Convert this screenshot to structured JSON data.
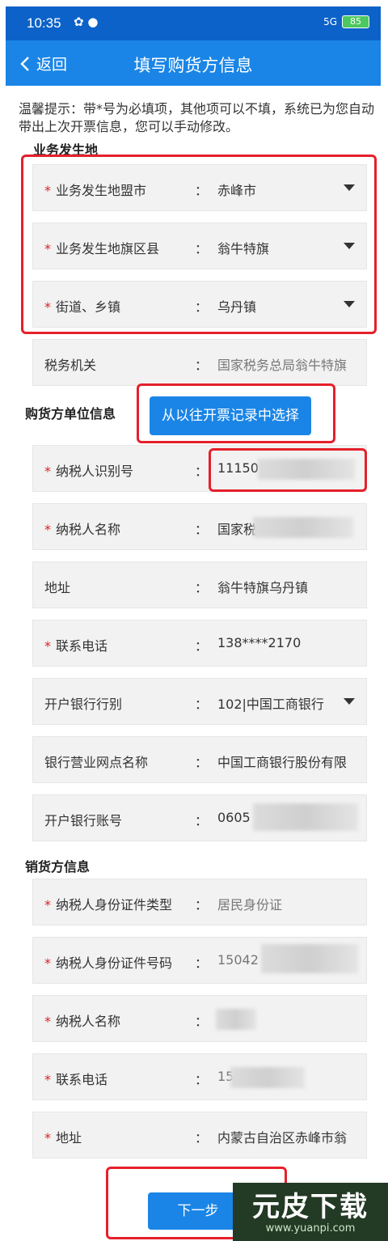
{
  "status": {
    "time": "10:35",
    "notif_icons": "✿ ●",
    "signal": "5G",
    "battery": "85"
  },
  "nav": {
    "back_label": "返回",
    "title": "填写购货方信息"
  },
  "tip": "温馨提示：带*号为必填项，其他项可以不填，系统已为您自动带出上次开票信息，您可以手动修改。",
  "sections": {
    "business_place": "业务发生地",
    "buyer_info": "购货方单位信息",
    "seller_info": "销货方信息"
  },
  "fields": {
    "league_city": {
      "label": "业务发生地盟市",
      "value": "赤峰市"
    },
    "district": {
      "label": "业务发生地旗区县",
      "value": "翁牛特旗"
    },
    "town": {
      "label": "街道、乡镇",
      "value": "乌丹镇"
    },
    "tax_office": {
      "label": "税务机关",
      "value": "国家税务总局翁牛特旗"
    },
    "taxpayer_id": {
      "label": "纳税人识别号",
      "value": "11150"
    },
    "taxpayer_name": {
      "label": "纳税人名称",
      "value": "国家税"
    },
    "address": {
      "label": "地址",
      "value": "翁牛特旗乌丹镇"
    },
    "phone": {
      "label": "联系电话",
      "value": "138****2170"
    },
    "bank": {
      "label": "开户银行行别",
      "value": "102|中国工商银行"
    },
    "bank_branch": {
      "label": "银行营业网点名称",
      "value": "中国工商银行股份有限"
    },
    "bank_account": {
      "label": "开户银行账号",
      "value": "0605"
    },
    "seller_id_type": {
      "label": "纳税人身份证件类型",
      "value": "居民身份证"
    },
    "seller_id_no": {
      "label": "纳税人身份证件号码",
      "value": "15042"
    },
    "seller_name": {
      "label": "纳税人名称",
      "value": ""
    },
    "seller_phone": {
      "label": "联系电话",
      "value": "15"
    },
    "seller_address": {
      "label": "地址",
      "value": "内蒙古自治区赤峰市翁"
    }
  },
  "colon": "：",
  "required_mark": "*",
  "buttons": {
    "pick_history": "从以往开票记录中选择",
    "next": "下一步"
  },
  "watermark": {
    "big": "元皮下载",
    "small": "www.yuanpi.com"
  },
  "colors": {
    "primary": "#1a85e6",
    "status_bar": "#0c62c8",
    "required": "#e02020",
    "highlight": "#e5202b"
  }
}
